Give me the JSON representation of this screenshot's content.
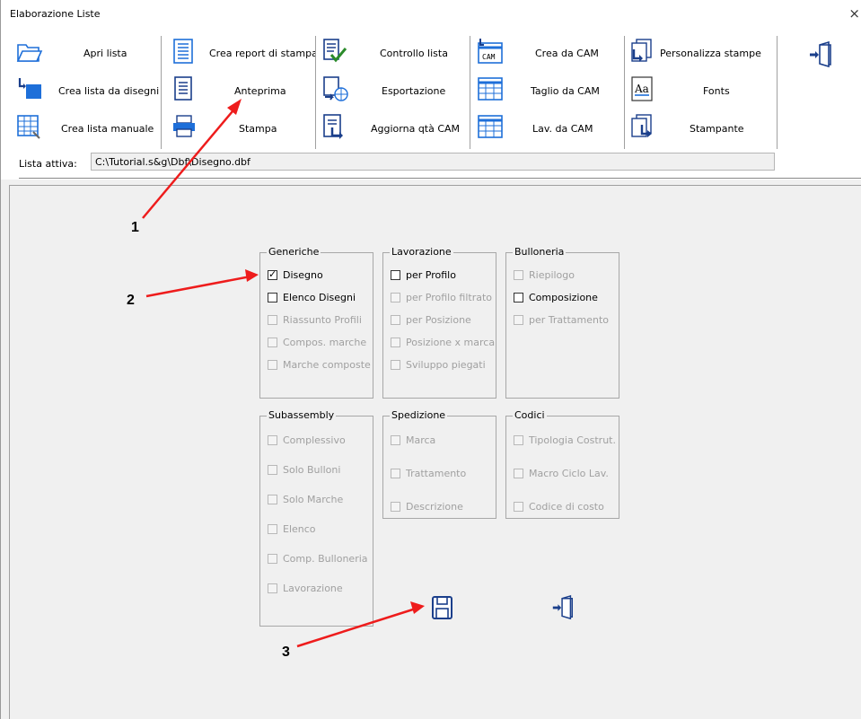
{
  "window": {
    "title": "Elaborazione Liste",
    "close_glyph": "×"
  },
  "toolbar": {
    "col1": [
      "Apri lista",
      "Crea lista da disegni",
      "Crea lista manuale"
    ],
    "col2": [
      "Crea report di stampa",
      "Anteprima",
      "Stampa"
    ],
    "col3": [
      "Controllo lista",
      "Esportazione",
      "Aggiorna qtà CAM"
    ],
    "col4": [
      "Crea da CAM",
      "Taglio da CAM",
      "Lav. da CAM"
    ],
    "col5": [
      "Personalizza stampe",
      "Fonts",
      "Stampante"
    ],
    "icons": {
      "col1": [
        "folder-open-icon",
        "new-list-from-drawings-icon",
        "manual-list-icon"
      ],
      "col2": [
        "report-template-icon",
        "preview-icon",
        "printer-icon"
      ],
      "col3": [
        "check-list-icon",
        "export-icon",
        "update-cam-qty-icon"
      ],
      "col4": [
        "cam-create-icon",
        "cam-cut-icon",
        "cam-work-icon"
      ],
      "col5": [
        "custom-print-icon",
        "fonts-icon",
        "printer-select-icon"
      ],
      "exit": "exit-door-icon"
    },
    "cam_badge": "CAM",
    "font_badge": "Aa"
  },
  "lista": {
    "label": "Lista attiva:",
    "value": "C:\\Tutorial.s&g\\Dbf\\Disegno.dbf"
  },
  "groups": {
    "generiche": {
      "title": "Generiche",
      "items": [
        {
          "label": "Disegno",
          "checked": true,
          "enabled": true
        },
        {
          "label": "Elenco Disegni",
          "checked": false,
          "enabled": true
        },
        {
          "label": "Riassunto Profili",
          "checked": false,
          "enabled": false
        },
        {
          "label": "Compos. marche",
          "checked": false,
          "enabled": false
        },
        {
          "label": "Marche composte",
          "checked": false,
          "enabled": false
        }
      ]
    },
    "lavorazione": {
      "title": "Lavorazione",
      "items": [
        {
          "label": "per Profilo",
          "checked": false,
          "enabled": true
        },
        {
          "label": "per Profilo filtrato",
          "checked": false,
          "enabled": false
        },
        {
          "label": "per Posizione",
          "checked": false,
          "enabled": false
        },
        {
          "label": "Posizione x marca",
          "checked": false,
          "enabled": false
        },
        {
          "label": "Sviluppo piegati",
          "checked": false,
          "enabled": false
        }
      ]
    },
    "bulloneria": {
      "title": "Bulloneria",
      "items": [
        {
          "label": "Riepilogo",
          "checked": false,
          "enabled": false
        },
        {
          "label": "Composizione",
          "checked": false,
          "enabled": true
        },
        {
          "label": "per Trattamento",
          "checked": false,
          "enabled": false
        }
      ]
    },
    "subassembly": {
      "title": "Subassembly",
      "items": [
        {
          "label": "Complessivo",
          "checked": false,
          "enabled": false
        },
        {
          "label": "Solo Bulloni",
          "checked": false,
          "enabled": false
        },
        {
          "label": "Solo Marche",
          "checked": false,
          "enabled": false
        },
        {
          "label": "Elenco",
          "checked": false,
          "enabled": false
        },
        {
          "label": "Comp. Bulloneria",
          "checked": false,
          "enabled": false
        },
        {
          "label": "Lavorazione",
          "checked": false,
          "enabled": false
        }
      ]
    },
    "spedizione": {
      "title": "Spedizione",
      "items": [
        {
          "label": "Marca",
          "checked": false,
          "enabled": false
        },
        {
          "label": "Trattamento",
          "checked": false,
          "enabled": false
        },
        {
          "label": "Descrizione",
          "checked": false,
          "enabled": false
        }
      ]
    },
    "codici": {
      "title": "Codici",
      "items": [
        {
          "label": "Tipologia Costrut.",
          "checked": false,
          "enabled": false
        },
        {
          "label": "Macro Ciclo Lav.",
          "checked": false,
          "enabled": false
        },
        {
          "label": "Codice di costo",
          "checked": false,
          "enabled": false
        }
      ]
    }
  },
  "check_glyph": "✓",
  "bottom_icons": {
    "save": "save-disk-icon",
    "exit": "exit-door-icon"
  },
  "annotations": {
    "a1": "1",
    "a2": "2",
    "a3": "3",
    "color": "#ee1c1c"
  },
  "colors": {
    "icon_blue": "#1e6fd9",
    "icon_dark": "#1b3f8b",
    "disabled": "#a0a0a0"
  }
}
